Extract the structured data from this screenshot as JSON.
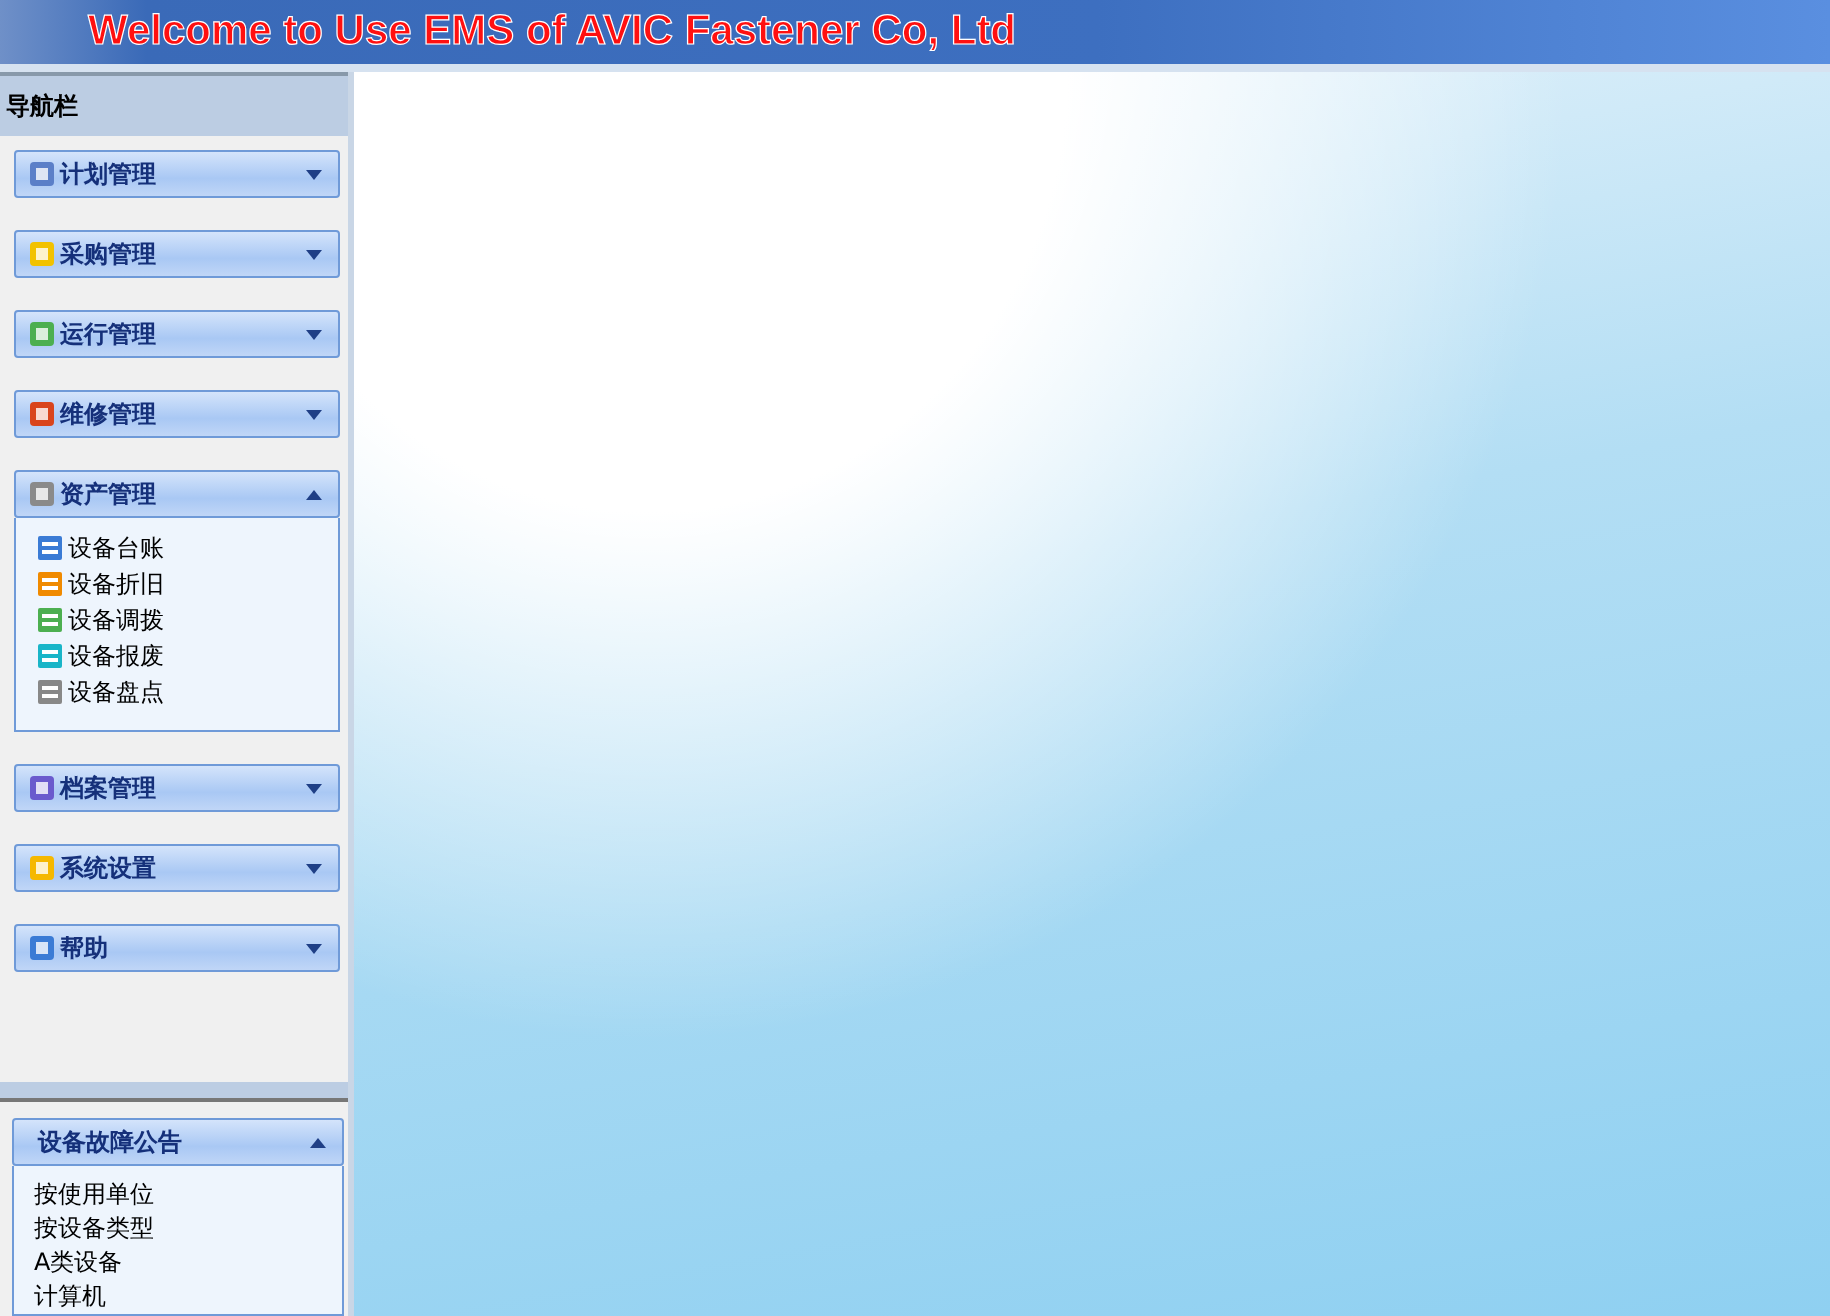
{
  "header": {
    "title": "Welcome to Use EMS of AVIC Fastener Co, Ltd"
  },
  "sidebar": {
    "title": "导航栏",
    "panels": [
      {
        "label": "计划管理",
        "expanded": false
      },
      {
        "label": "采购管理",
        "expanded": false
      },
      {
        "label": "运行管理",
        "expanded": false
      },
      {
        "label": "维修管理",
        "expanded": false
      },
      {
        "label": "资产管理",
        "expanded": true,
        "items": [
          "设备台账",
          "设备折旧",
          "设备调拨",
          "设备报废",
          "设备盘点"
        ]
      },
      {
        "label": "档案管理",
        "expanded": false
      },
      {
        "label": "系统设置",
        "expanded": false
      },
      {
        "label": "帮助",
        "expanded": false
      }
    ]
  },
  "notice": {
    "label": "设备故障公告",
    "expanded": true,
    "items": [
      "按使用单位",
      "按设备类型",
      "A类设备",
      "计算机"
    ]
  }
}
